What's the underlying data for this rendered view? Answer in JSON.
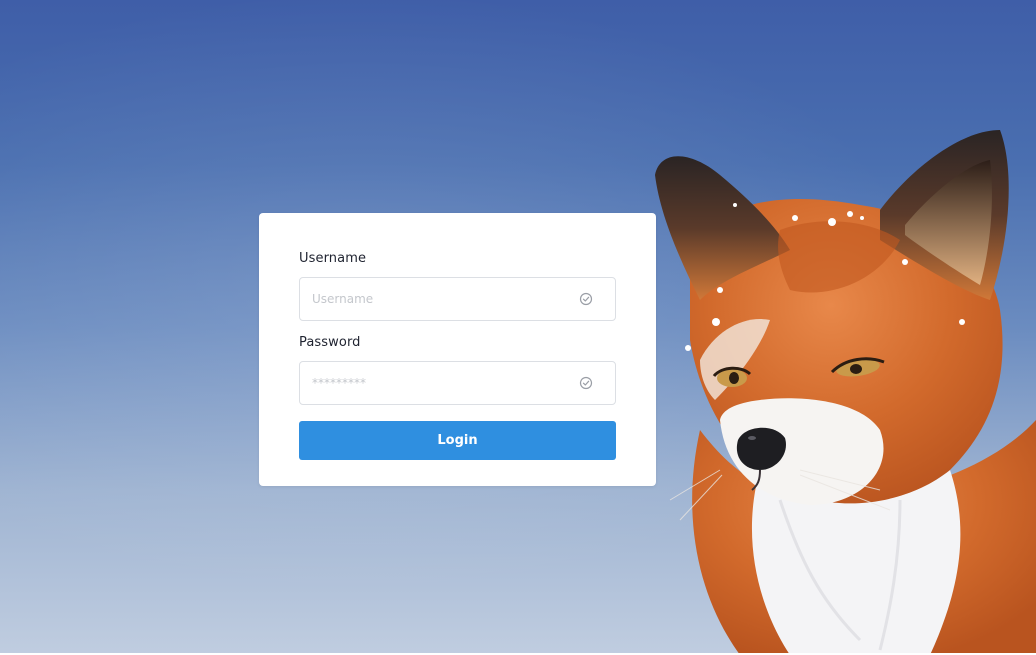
{
  "login_form": {
    "username_label": "Username",
    "username_placeholder": "Username",
    "username_value": "",
    "password_label": "Password",
    "password_placeholder": "*********",
    "password_value": "",
    "login_button": "Login"
  },
  "icons": {
    "username_status": "check-circle-icon",
    "password_status": "check-circle-icon"
  },
  "colors": {
    "primary_button": "#2f8fe0",
    "background_top": "#3f5ea8",
    "background_bottom": "#c0cde0"
  }
}
